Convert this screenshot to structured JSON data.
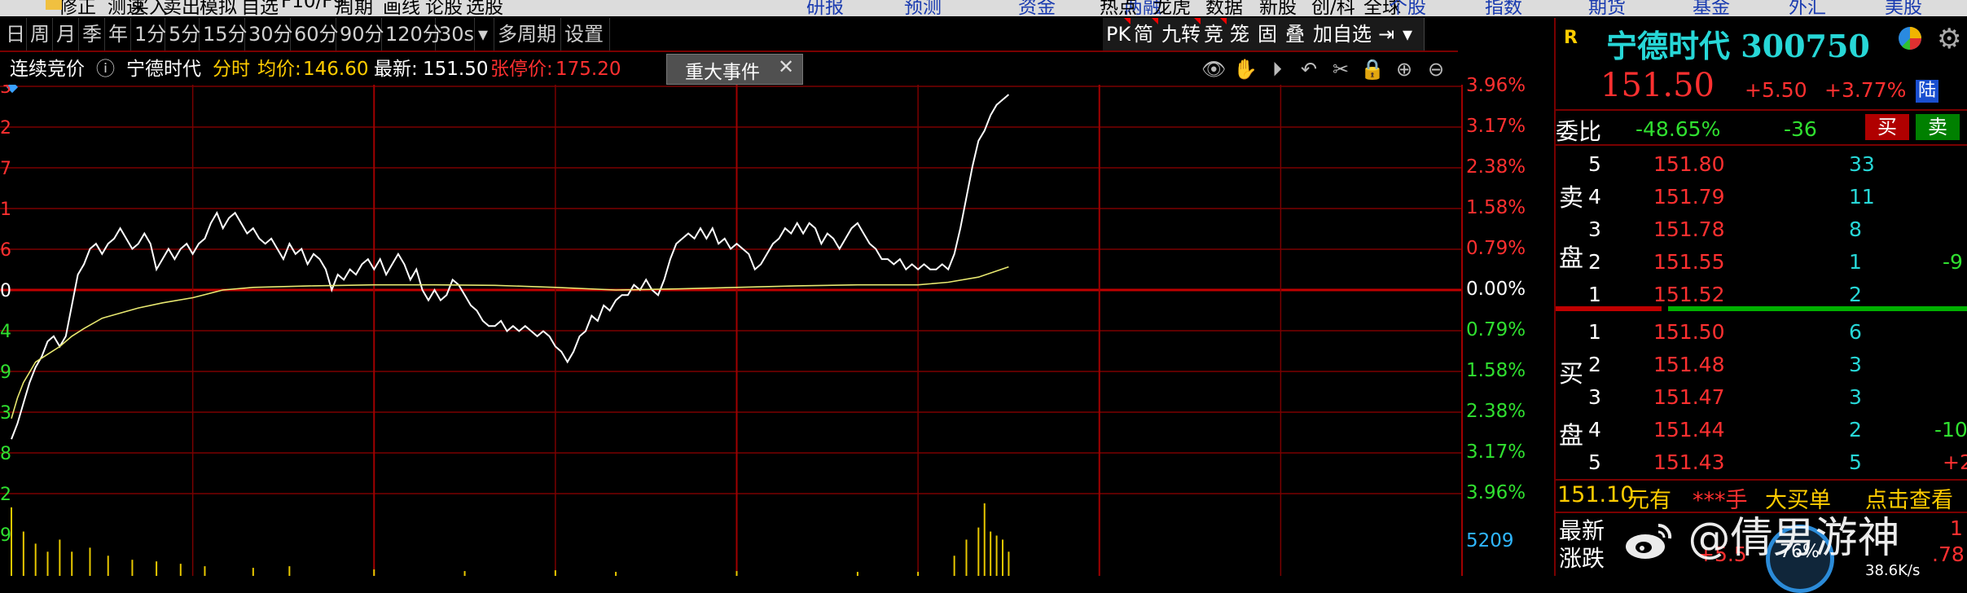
{
  "menu": {
    "items": [
      "修正",
      "测速",
      "买入",
      "卖出",
      "模拟",
      "自选",
      "F10/F9",
      "周期",
      "画线",
      "论股",
      "选股"
    ],
    "blue_items": [
      "研报",
      "预测",
      "资金",
      "两融"
    ],
    "right_items": [
      "热点",
      "龙虎",
      "数据",
      "新股",
      "创/科",
      "全球"
    ],
    "blue_right_items": [
      "个股",
      "指数",
      "期货",
      "基金",
      "外汇",
      "美股"
    ]
  },
  "period_bar": {
    "items": [
      "日",
      "周",
      "月",
      "季",
      "年",
      "1分",
      "5分",
      "15分",
      "30分",
      "60分",
      "90分",
      "120分",
      "30s",
      "▾",
      "多周期",
      "设置"
    ]
  },
  "right_tools": [
    "PK",
    "简",
    "九转",
    "竞",
    "笼",
    "固",
    "叠",
    "加自选",
    "⇥",
    "▾"
  ],
  "info": {
    "auction": "连续竞价",
    "info_icon": "ⓘ",
    "name": "宁德时代",
    "mode": "分时",
    "avg_label": "均价:",
    "avg_value": "146.60",
    "last_label": "最新:",
    "last_value": "151.50",
    "limit_label": "张停价:",
    "limit_value": "175.20"
  },
  "event_tab": {
    "label": "重大事件",
    "close": "✕"
  },
  "chart_icons": [
    "eye-icon",
    "hand-icon",
    "play-icon",
    "undo-icon",
    "scissors-icon",
    "lock-icon",
    "zoom-in-icon",
    "zoom-out-icon"
  ],
  "chart_icon_glyphs": [
    "👁",
    "✋",
    "⏵",
    "↶",
    "✂",
    "🔒",
    "⊕",
    "⊖"
  ],
  "chart_data": {
    "type": "line",
    "y_axis_right": [
      "3.96%",
      "3.17%",
      "2.38%",
      "1.58%",
      "0.79%",
      "0.00%",
      "0.79%",
      "1.58%",
      "2.38%",
      "3.17%",
      "3.96%"
    ],
    "y_axis_right_colors": [
      "#ff3030",
      "#ff3030",
      "#ff3030",
      "#ff3030",
      "#ff3030",
      "#ffffff",
      "#30e030",
      "#30e030",
      "#30e030",
      "#30e030",
      "#30e030"
    ],
    "y_axis_left_fragments": [
      "3",
      "2",
      "7",
      "1",
      "6",
      "0",
      "4",
      "9",
      "3",
      "8",
      "2",
      "9"
    ],
    "pct_range": [
      -3.96,
      3.96
    ],
    "minutes_total": 240,
    "series": [
      {
        "name": "最新",
        "color": "#ffffff",
        "points": [
          [
            0,
            -2.9
          ],
          [
            1,
            -2.6
          ],
          [
            2,
            -2.2
          ],
          [
            3,
            -1.8
          ],
          [
            4,
            -1.5
          ],
          [
            5,
            -1.3
          ],
          [
            6,
            -1.0
          ],
          [
            7,
            -0.9
          ],
          [
            8,
            -1.1
          ],
          [
            9,
            -0.9
          ],
          [
            10,
            -0.3
          ],
          [
            11,
            0.3
          ],
          [
            12,
            0.5
          ],
          [
            13,
            0.8
          ],
          [
            14,
            0.9
          ],
          [
            15,
            0.7
          ],
          [
            16,
            0.9
          ],
          [
            17,
            1.0
          ],
          [
            18,
            1.2
          ],
          [
            19,
            1.0
          ],
          [
            20,
            0.8
          ],
          [
            21,
            0.9
          ],
          [
            22,
            1.1
          ],
          [
            23,
            0.9
          ],
          [
            24,
            0.4
          ],
          [
            25,
            0.6
          ],
          [
            26,
            0.8
          ],
          [
            27,
            0.6
          ],
          [
            28,
            0.8
          ],
          [
            29,
            0.9
          ],
          [
            30,
            0.7
          ],
          [
            31,
            0.9
          ],
          [
            32,
            1.0
          ],
          [
            33,
            1.3
          ],
          [
            34,
            1.5
          ],
          [
            35,
            1.2
          ],
          [
            36,
            1.4
          ],
          [
            37,
            1.5
          ],
          [
            38,
            1.3
          ],
          [
            39,
            1.1
          ],
          [
            40,
            1.2
          ],
          [
            41,
            1.0
          ],
          [
            42,
            0.9
          ],
          [
            43,
            1.0
          ],
          [
            44,
            0.8
          ],
          [
            45,
            0.6
          ],
          [
            46,
            0.9
          ],
          [
            47,
            0.7
          ],
          [
            48,
            0.8
          ],
          [
            49,
            0.5
          ],
          [
            50,
            0.7
          ],
          [
            51,
            0.6
          ],
          [
            52,
            0.4
          ],
          [
            53,
            0.0
          ],
          [
            54,
            0.3
          ],
          [
            55,
            0.2
          ],
          [
            56,
            0.4
          ],
          [
            57,
            0.3
          ],
          [
            58,
            0.5
          ],
          [
            59,
            0.6
          ],
          [
            60,
            0.4
          ],
          [
            61,
            0.6
          ],
          [
            62,
            0.3
          ],
          [
            63,
            0.5
          ],
          [
            64,
            0.7
          ],
          [
            65,
            0.5
          ],
          [
            66,
            0.2
          ],
          [
            67,
            0.4
          ],
          [
            68,
            0.0
          ],
          [
            69,
            -0.2
          ],
          [
            70,
            0.0
          ],
          [
            71,
            -0.2
          ],
          [
            72,
            -0.1
          ],
          [
            73,
            0.2
          ],
          [
            74,
            0.1
          ],
          [
            75,
            -0.1
          ],
          [
            76,
            -0.3
          ],
          [
            77,
            -0.4
          ],
          [
            78,
            -0.6
          ],
          [
            79,
            -0.7
          ],
          [
            80,
            -0.7
          ],
          [
            81,
            -0.6
          ],
          [
            82,
            -0.8
          ],
          [
            83,
            -0.7
          ],
          [
            84,
            -0.8
          ],
          [
            85,
            -0.7
          ],
          [
            86,
            -0.8
          ],
          [
            87,
            -0.9
          ],
          [
            88,
            -0.8
          ],
          [
            89,
            -0.9
          ],
          [
            90,
            -1.1
          ],
          [
            91,
            -1.2
          ],
          [
            92,
            -1.4
          ],
          [
            93,
            -1.2
          ],
          [
            94,
            -0.9
          ],
          [
            95,
            -0.8
          ],
          [
            96,
            -0.5
          ],
          [
            97,
            -0.6
          ],
          [
            98,
            -0.3
          ],
          [
            99,
            -0.4
          ],
          [
            100,
            -0.2
          ],
          [
            101,
            -0.1
          ],
          [
            102,
            -0.1
          ],
          [
            103,
            0.1
          ],
          [
            104,
            0.0
          ],
          [
            105,
            0.2
          ],
          [
            106,
            0.0
          ],
          [
            107,
            -0.1
          ],
          [
            108,
            0.2
          ],
          [
            109,
            0.6
          ],
          [
            110,
            0.9
          ],
          [
            111,
            1.0
          ],
          [
            112,
            1.1
          ],
          [
            113,
            1.0
          ],
          [
            114,
            1.2
          ],
          [
            115,
            1.0
          ],
          [
            116,
            1.2
          ],
          [
            117,
            0.9
          ],
          [
            118,
            1.0
          ],
          [
            119,
            0.8
          ],
          [
            120,
            0.9
          ],
          [
            121,
            0.8
          ],
          [
            122,
            0.7
          ],
          [
            123,
            0.4
          ],
          [
            124,
            0.5
          ],
          [
            125,
            0.7
          ],
          [
            126,
            0.9
          ],
          [
            127,
            1.0
          ],
          [
            128,
            1.2
          ],
          [
            129,
            1.1
          ],
          [
            130,
            1.3
          ],
          [
            131,
            1.1
          ],
          [
            132,
            1.3
          ],
          [
            133,
            1.2
          ],
          [
            134,
            0.9
          ],
          [
            135,
            1.1
          ],
          [
            136,
            1.0
          ],
          [
            137,
            0.8
          ],
          [
            138,
            1.0
          ],
          [
            139,
            1.2
          ],
          [
            140,
            1.3
          ],
          [
            141,
            1.1
          ],
          [
            142,
            0.9
          ],
          [
            143,
            0.8
          ],
          [
            144,
            0.6
          ],
          [
            145,
            0.6
          ],
          [
            146,
            0.5
          ],
          [
            147,
            0.6
          ],
          [
            148,
            0.4
          ],
          [
            149,
            0.5
          ],
          [
            150,
            0.4
          ],
          [
            151,
            0.5
          ],
          [
            152,
            0.4
          ],
          [
            153,
            0.4
          ],
          [
            154,
            0.5
          ],
          [
            155,
            0.4
          ],
          [
            156,
            0.7
          ],
          [
            157,
            1.2
          ],
          [
            158,
            1.8
          ],
          [
            159,
            2.4
          ],
          [
            160,
            2.9
          ],
          [
            161,
            3.1
          ],
          [
            162,
            3.4
          ],
          [
            163,
            3.6
          ],
          [
            164,
            3.7
          ],
          [
            165,
            3.8
          ]
        ]
      },
      {
        "name": "均价",
        "color": "#e8e870",
        "points": [
          [
            0,
            -2.5
          ],
          [
            1,
            -2.1
          ],
          [
            2,
            -1.8
          ],
          [
            3,
            -1.6
          ],
          [
            4,
            -1.4
          ],
          [
            6,
            -1.25
          ],
          [
            8,
            -1.1
          ],
          [
            10,
            -0.9
          ],
          [
            12,
            -0.75
          ],
          [
            15,
            -0.55
          ],
          [
            18,
            -0.45
          ],
          [
            21,
            -0.35
          ],
          [
            25,
            -0.25
          ],
          [
            30,
            -0.15
          ],
          [
            35,
            0.0
          ],
          [
            40,
            0.05
          ],
          [
            50,
            0.08
          ],
          [
            60,
            0.1
          ],
          [
            70,
            0.1
          ],
          [
            80,
            0.09
          ],
          [
            90,
            0.05
          ],
          [
            100,
            0.0
          ],
          [
            110,
            0.02
          ],
          [
            120,
            0.05
          ],
          [
            130,
            0.08
          ],
          [
            140,
            0.1
          ],
          [
            150,
            0.1
          ],
          [
            155,
            0.15
          ],
          [
            160,
            0.25
          ],
          [
            165,
            0.45
          ]
        ]
      }
    ],
    "volume": {
      "label": "5209",
      "bars": [
        [
          0,
          0.85
        ],
        [
          2,
          0.55
        ],
        [
          4,
          0.4
        ],
        [
          6,
          0.3
        ],
        [
          8,
          0.45
        ],
        [
          10,
          0.3
        ],
        [
          13,
          0.35
        ],
        [
          16,
          0.25
        ],
        [
          20,
          0.2
        ],
        [
          24,
          0.18
        ],
        [
          28,
          0.15
        ],
        [
          32,
          0.12
        ],
        [
          40,
          0.1
        ],
        [
          46,
          0.12
        ],
        [
          60,
          0.08
        ],
        [
          75,
          0.06
        ],
        [
          90,
          0.07
        ],
        [
          100,
          0.05
        ],
        [
          120,
          0.06
        ],
        [
          140,
          0.05
        ],
        [
          150,
          0.05
        ],
        [
          156,
          0.25
        ],
        [
          158,
          0.45
        ],
        [
          160,
          0.6
        ],
        [
          161,
          0.9
        ],
        [
          162,
          0.55
        ],
        [
          163,
          0.5
        ],
        [
          164,
          0.45
        ],
        [
          165,
          0.3
        ]
      ]
    }
  },
  "quote": {
    "r_badge": "R",
    "title": "宁德时代 300750",
    "price": "151.50",
    "change": "+5.50",
    "change_pct": "+3.77%",
    "lu_badge": "陆",
    "weibi_label": "委比",
    "weibi_value": "-48.65%",
    "weicha_value": "-36",
    "buy_btn": "买",
    "sell_btn": "卖",
    "sell_label": [
      "卖",
      "盘"
    ],
    "buy_label": [
      "买",
      "盘"
    ],
    "sell_rows": [
      {
        "level": "5",
        "price": "151.80",
        "vol": "33",
        "delta": ""
      },
      {
        "level": "4",
        "price": "151.79",
        "vol": "11",
        "delta": ""
      },
      {
        "level": "3",
        "price": "151.78",
        "vol": "8",
        "delta": ""
      },
      {
        "level": "2",
        "price": "151.55",
        "vol": "1",
        "delta": "-9"
      },
      {
        "level": "1",
        "price": "151.52",
        "vol": "2",
        "delta": ""
      }
    ],
    "buy_rows": [
      {
        "level": "1",
        "price": "151.50",
        "vol": "6",
        "delta": ""
      },
      {
        "level": "2",
        "price": "151.48",
        "vol": "3",
        "delta": ""
      },
      {
        "level": "3",
        "price": "151.47",
        "vol": "3",
        "delta": ""
      },
      {
        "level": "4",
        "price": "151.44",
        "vol": "2",
        "delta": "-10"
      },
      {
        "level": "5",
        "price": "151.43",
        "vol": "5",
        "delta": "+2"
      }
    ],
    "big_order_price": "151.10",
    "big_order_text": "元有",
    "big_order_hidden": "***手",
    "big_order_label": "大买单",
    "big_order_link": "点击查看",
    "latest_label": "最新",
    "change_label": "涨跌",
    "change_value": "+5.5",
    "right_frag_1": "1",
    "right_frag_2": ".78",
    "gauge_text": "76%",
    "speed_text": "38.6K/s"
  },
  "watermark": "@倩男游神"
}
